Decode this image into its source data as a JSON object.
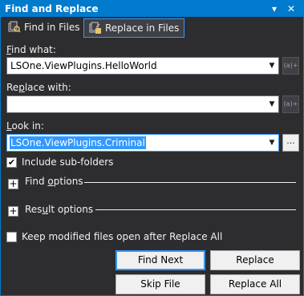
{
  "window": {
    "title": "Find and Replace",
    "pin_glyph": "▾",
    "pin_icon": "pin-icon",
    "close_glyph": "✕",
    "close_icon": "close-icon"
  },
  "tabs": [
    {
      "label": "Find in Files",
      "icon": "find-in-files-icon",
      "active": false
    },
    {
      "label": "Replace in Files",
      "icon": "replace-in-files-icon",
      "active": true
    }
  ],
  "find_what": {
    "label_accel": "F",
    "label_rest": "ind what:",
    "value": "LSOne.ViewPlugins.HelloWorld",
    "regex_button": "(a)+"
  },
  "replace_with": {
    "label_pre": "Re",
    "label_accel": "p",
    "label_rest": "lace with:",
    "value": "",
    "regex_button": "(a)+"
  },
  "look_in": {
    "label_accel": "L",
    "label_rest": "ook in:",
    "value": "LSOne.ViewPlugins.Criminal",
    "browse_button": "..."
  },
  "include_subfolders": {
    "label": "Include sub-folders",
    "checked": true,
    "check_glyph": "✔"
  },
  "find_options": {
    "label_pre": "Find ",
    "label_accel": "o",
    "label_rest": "ptions",
    "expander": "+"
  },
  "result_options": {
    "label_pre": "Res",
    "label_accel": "u",
    "label_rest": "lt options",
    "expander": "+"
  },
  "keep_open": {
    "label": "Keep modified files open after Replace All",
    "checked": false
  },
  "buttons": {
    "find_next": "Find Next",
    "replace": "Replace",
    "skip_file": "Skip File",
    "replace_all": "Replace All"
  },
  "colors": {
    "accent": "#007acc",
    "background": "#2d2d30",
    "selection": "#3399ff"
  }
}
